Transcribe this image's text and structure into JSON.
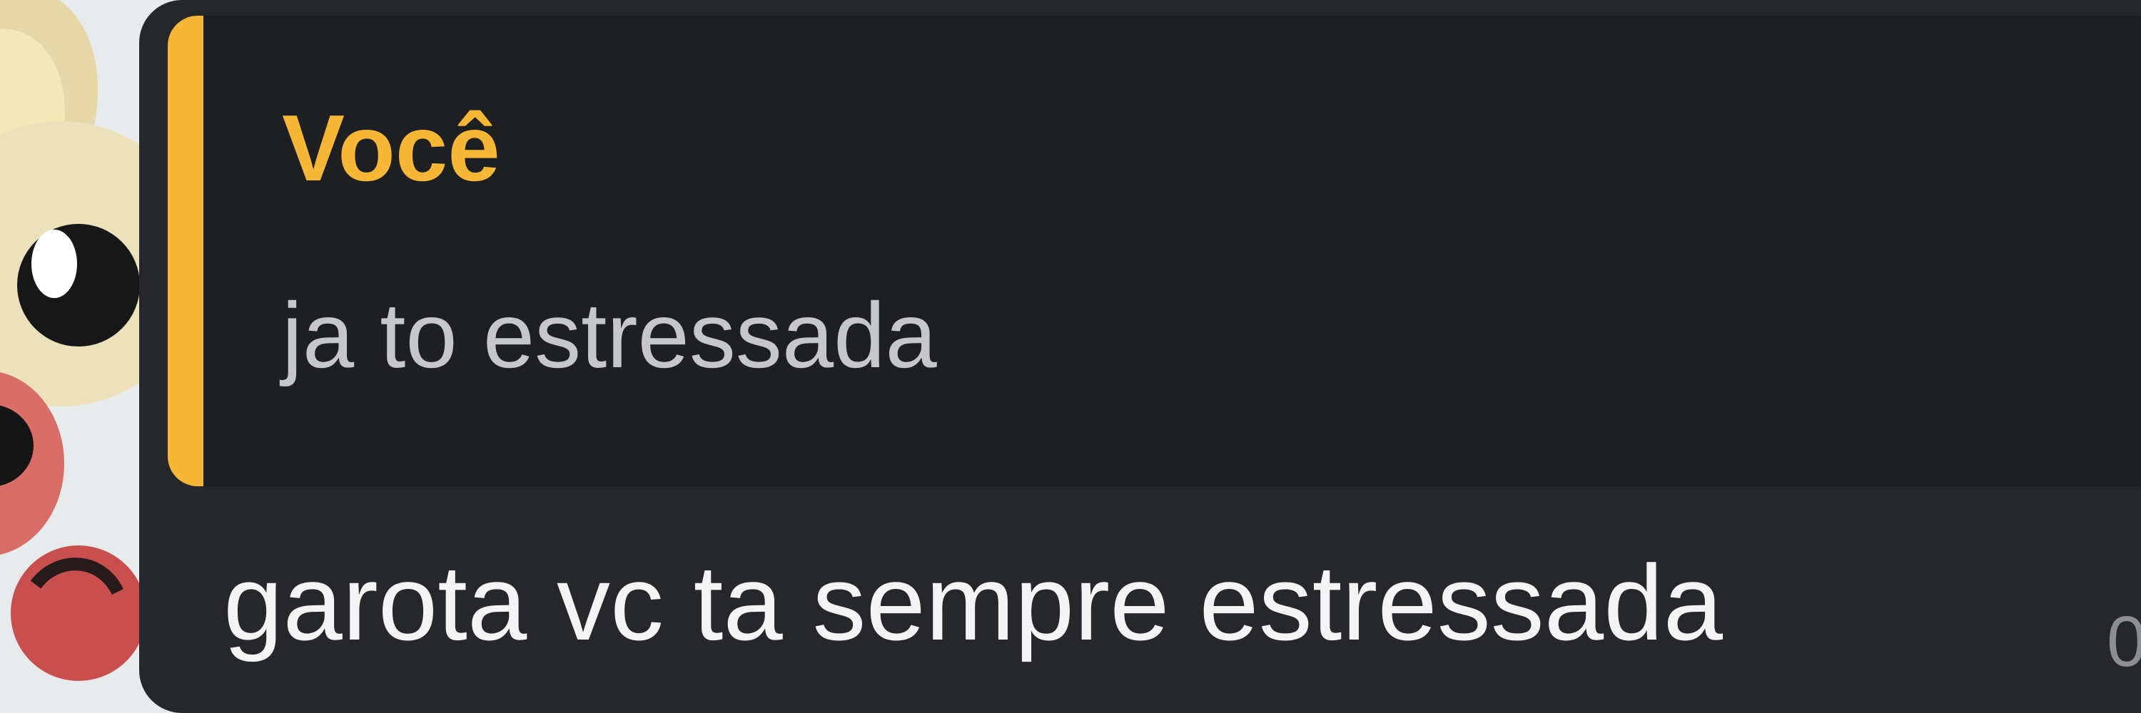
{
  "reply": {
    "author": "Você",
    "text": "ja to estressada"
  },
  "message": {
    "text": "garota vc ta sempre estressada",
    "time": "0"
  },
  "colors": {
    "accent": "#f6b636",
    "bubble": "#26272b",
    "reply_background": "#1e1f21",
    "message_text": "#f4f4f5",
    "reply_text": "#c6c7c9"
  },
  "icons": {
    "avatar": "cartoon-avatar-icon"
  }
}
